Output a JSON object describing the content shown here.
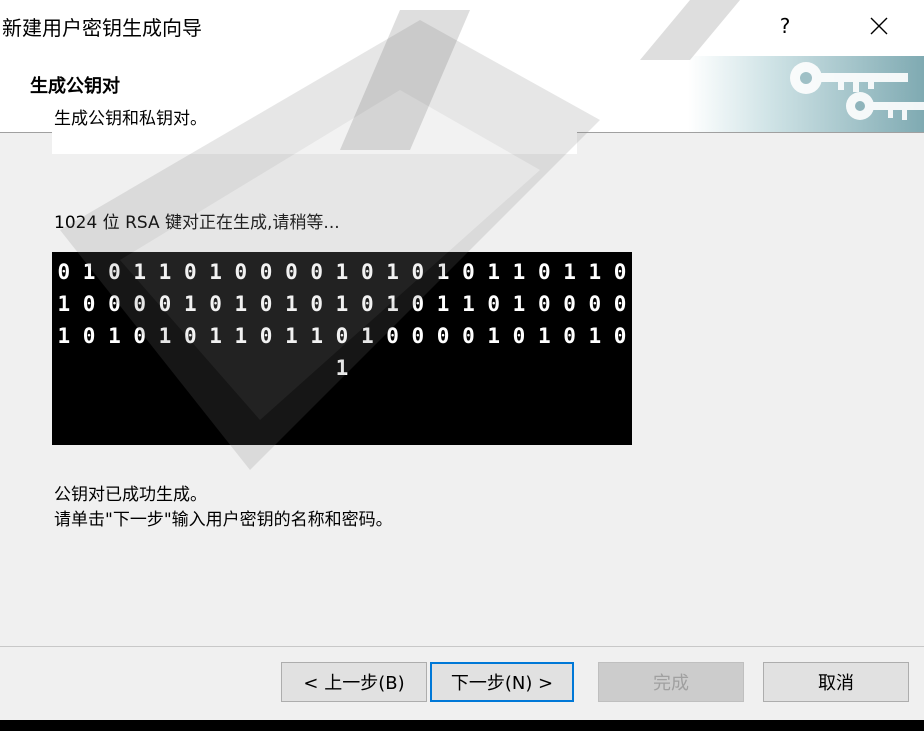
{
  "window": {
    "title": "新建用户密钥生成向导",
    "help_label": "?",
    "close_label": "✕"
  },
  "header": {
    "title": "生成公钥对",
    "subtitle": "生成公钥和私钥对。"
  },
  "main": {
    "status_label": "1024 位 RSA 键对正在生成,请稍等...",
    "binary_lines": [
      "0 1 0 1 1 0 1 0 0 0 0 1 0 1 0 1 0 1 1 0 1 1 0",
      "1 0 0 0 0 1 0 1 0 1 0 1 0 1 0 1 1 0 1 0 0 0 0",
      "1 0 1 0 1 0 1 1 0 1 1 0 1 0 0 0 0 1 0 1 0 1 0",
      "1"
    ],
    "message_line1": "公钥对已成功生成。",
    "message_line2": "请单击\"下一步\"输入用户密钥的名称和密码。"
  },
  "buttons": {
    "back": "< 上一步(B)",
    "next": "下一步(N) >",
    "finish": "完成",
    "cancel": "取消"
  },
  "colors": {
    "accent": "#0078d7",
    "dialog_bg": "#f0f0f0",
    "binary_bg": "#000000"
  }
}
